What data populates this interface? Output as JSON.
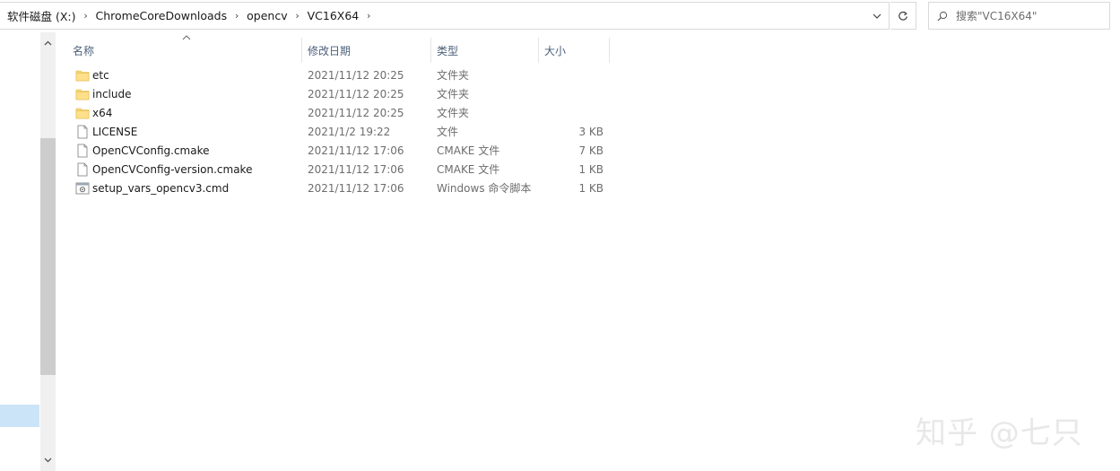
{
  "address_bar": {
    "crumbs": [
      "软件磁盘 (X:)",
      "ChromeCoreDownloads",
      "opencv",
      "VC16X64"
    ]
  },
  "search": {
    "placeholder": "搜索\"VC16X64\""
  },
  "columns": {
    "name": "名称",
    "date": "修改日期",
    "type": "类型",
    "size": "大小"
  },
  "files": [
    {
      "icon": "folder-icon",
      "name": "etc",
      "date": "2021/11/12 20:25",
      "type": "文件夹",
      "size": ""
    },
    {
      "icon": "folder-icon",
      "name": "include",
      "date": "2021/11/12 20:25",
      "type": "文件夹",
      "size": ""
    },
    {
      "icon": "folder-icon",
      "name": "x64",
      "date": "2021/11/12 20:25",
      "type": "文件夹",
      "size": ""
    },
    {
      "icon": "file-icon",
      "name": "LICENSE",
      "date": "2021/1/2 19:22",
      "type": "文件",
      "size": "3 KB"
    },
    {
      "icon": "file-icon",
      "name": "OpenCVConfig.cmake",
      "date": "2021/11/12 17:06",
      "type": "CMAKE 文件",
      "size": "7 KB"
    },
    {
      "icon": "file-icon",
      "name": "OpenCVConfig-version.cmake",
      "date": "2021/11/12 17:06",
      "type": "CMAKE 文件",
      "size": "1 KB"
    },
    {
      "icon": "script-icon",
      "name": "setup_vars_opencv3.cmd",
      "date": "2021/11/12 17:06",
      "type": "Windows 命令脚本",
      "size": "1 KB"
    }
  ],
  "watermark": "知乎 @七只",
  "colors": {
    "folder": "#f8d775",
    "selection": "#cce4f7",
    "header_text": "#4c607a"
  }
}
